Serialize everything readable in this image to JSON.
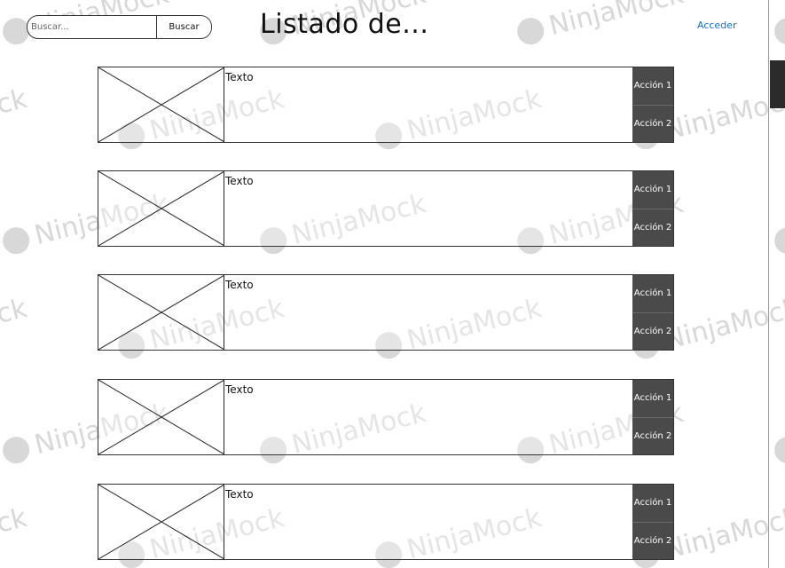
{
  "header": {
    "search_placeholder": "Buscar...",
    "search_button_label": "Buscar",
    "title": "Listado de...",
    "login_link_label": "Acceder"
  },
  "list": {
    "items": [
      {
        "text": "Texto",
        "action_1_label": "Acción 1",
        "action_2_label": "Acción 2"
      },
      {
        "text": "Texto",
        "action_1_label": "Acción 1",
        "action_2_label": "Acción 2"
      },
      {
        "text": "Texto",
        "action_1_label": "Acción 1",
        "action_2_label": "Acción 2"
      },
      {
        "text": "Texto",
        "action_1_label": "Acción 1",
        "action_2_label": "Acción 2"
      },
      {
        "text": "Texto",
        "action_1_label": "Acción 1",
        "action_2_label": "Acción 2"
      }
    ]
  },
  "watermark": {
    "text": "NinjaMock"
  },
  "colors": {
    "action_panel": "#4a4a4a",
    "link": "#1a6fd0",
    "watermark": "#d8d8d8"
  }
}
